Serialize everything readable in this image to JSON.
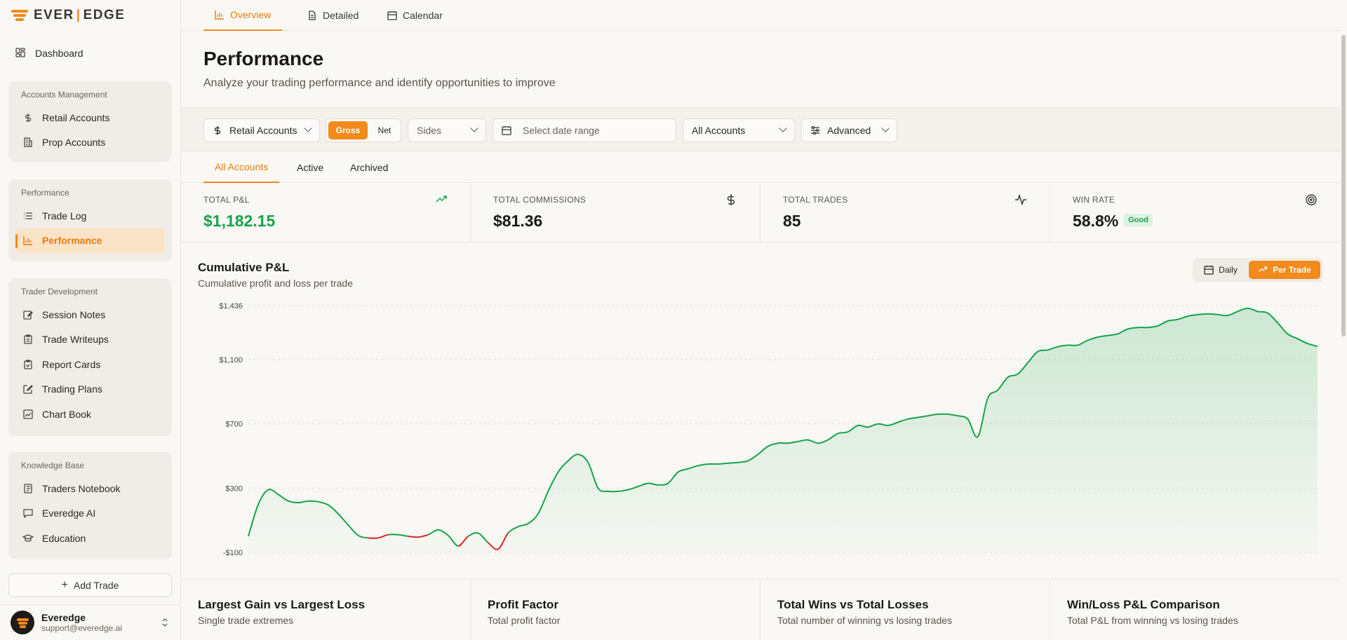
{
  "brand": {
    "logo_left": "EVER",
    "logo_right": "EDGE"
  },
  "sidebar": {
    "dashboard": "Dashboard",
    "groups": [
      {
        "title": "Accounts Management",
        "items": [
          "Retail Accounts",
          "Prop Accounts"
        ]
      },
      {
        "title": "Performance",
        "items": [
          "Trade Log",
          "Performance"
        ]
      },
      {
        "title": "Trader Development",
        "items": [
          "Session Notes",
          "Trade Writeups",
          "Report Cards",
          "Trading Plans",
          "Chart Book"
        ]
      },
      {
        "title": "Knowledge Base",
        "items": [
          "Traders Notebook",
          "Everedge AI",
          "Education"
        ]
      }
    ],
    "add_trade": "Add Trade",
    "user": {
      "name": "Everedge",
      "email": "support@everedge.ai"
    }
  },
  "topnav": {
    "tabs": [
      "Overview",
      "Detailed",
      "Calendar"
    ]
  },
  "page": {
    "title": "Performance",
    "subtitle": "Analyze your trading performance and identify opportunities to improve"
  },
  "filters": {
    "account_type": "Retail Accounts",
    "gross": "Gross",
    "net": "Net",
    "sides": "Sides",
    "date_placeholder": "Select date range",
    "accounts": "All Accounts",
    "advanced": "Advanced"
  },
  "subtabs": [
    "All Accounts",
    "Active",
    "Archived"
  ],
  "stats": [
    {
      "label": "Total P&L",
      "value": "$1,182.15"
    },
    {
      "label": "Total Commissions",
      "value": "$81.36"
    },
    {
      "label": "Total Trades",
      "value": "85"
    },
    {
      "label": "Win Rate",
      "value": "58.8%",
      "badge": "Good"
    }
  ],
  "chart_header": {
    "title": "Cumulative P&L",
    "subtitle": "Cumulative profit and loss per trade",
    "daily": "Daily",
    "per_trade": "Per Trade"
  },
  "chart_data": {
    "type": "area",
    "title": "Cumulative P&L",
    "subtitle": "Cumulative profit and loss per trade",
    "y_ticks": [
      {
        "value": 1436,
        "label": "$1,436"
      },
      {
        "value": 1100,
        "label": "$1,100"
      },
      {
        "value": 700,
        "label": "$700"
      },
      {
        "value": 300,
        "label": "$300"
      },
      {
        "value": -100,
        "label": "-$100"
      }
    ],
    "ylim": [
      -100,
      1436
    ],
    "grid": true,
    "colors": {
      "positive": "#16a34a",
      "negative": "#dc2626"
    },
    "series": [
      {
        "values": [
          0,
          200,
          290,
          260,
          220,
          210,
          220,
          215,
          195,
          140,
          70,
          5,
          -10,
          -10,
          10,
          10,
          0,
          -5,
          10,
          40,
          5,
          -60,
          0,
          20,
          -40,
          -80,
          20,
          60,
          80,
          140,
          280,
          400,
          470,
          510,
          460,
          300,
          280,
          280,
          290,
          310,
          330,
          320,
          330,
          400,
          420,
          440,
          450,
          450,
          455,
          460,
          470,
          510,
          560,
          580,
          580,
          590,
          600,
          580,
          600,
          640,
          650,
          690,
          680,
          700,
          690,
          710,
          730,
          740,
          750,
          760,
          760,
          750,
          730,
          620,
          860,
          910,
          990,
          1010,
          1080,
          1150,
          1160,
          1180,
          1190,
          1190,
          1220,
          1240,
          1250,
          1260,
          1290,
          1300,
          1300,
          1310,
          1340,
          1350,
          1370,
          1380,
          1385,
          1380,
          1375,
          1400,
          1420,
          1400,
          1390,
          1330,
          1260,
          1230,
          1200,
          1182
        ]
      }
    ]
  },
  "bottom_cards": [
    {
      "title": "Largest Gain vs Largest Loss",
      "subtitle": "Single trade extremes"
    },
    {
      "title": "Profit Factor",
      "subtitle": "Total profit factor"
    },
    {
      "title": "Total Wins vs Total Losses",
      "subtitle": "Total number of winning vs losing trades"
    },
    {
      "title": "Win/Loss P&L Comparison",
      "subtitle": "Total P&L from winning vs losing trades"
    }
  ]
}
